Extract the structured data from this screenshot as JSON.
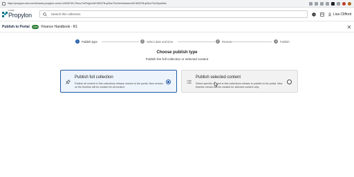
{
  "browser": {
    "url": "https://propylon-dev.com/Amears.propylon.com/c/-e904f749-CHuvc7mFhlg/c/4b7d5327B-q03sc70u/Vo/releases/4b7d5327B-q03sc70u/X/publish"
  },
  "header": {
    "env_label": "Local",
    "logo_text": "Propylon",
    "search_placeholder": "Search this collection",
    "user_name": "Lisa Clifford"
  },
  "title_bar": {
    "page_title": "Publish to Portal",
    "status_badge": "Live",
    "document_name": "Finance Handbook - R1"
  },
  "stepper": {
    "steps": [
      {
        "number": "1",
        "label": "Publish type",
        "active": true
      },
      {
        "number": "2",
        "label": "Select date and time",
        "active": false
      },
      {
        "number": "3",
        "label": "Review",
        "active": false
      },
      {
        "number": "4",
        "label": "Publish",
        "active": false
      }
    ]
  },
  "main": {
    "heading": "Choose publish type",
    "subheading": "Publish the full collection or selected content",
    "options": [
      {
        "title": "Publish full collection",
        "description": "Publish all content in this collections release version to the portal. New version on the timeline will be created for all content.",
        "selected": true
      },
      {
        "title": "Publish selected content",
        "description": "Select specific content in this collections release to publish to the portal. New timeline version will be created for selected content only.",
        "selected": false
      }
    ]
  },
  "colors": {
    "accent": "#1e5aa8",
    "brand": "#0c6f82",
    "badge": "#2e7d32"
  }
}
